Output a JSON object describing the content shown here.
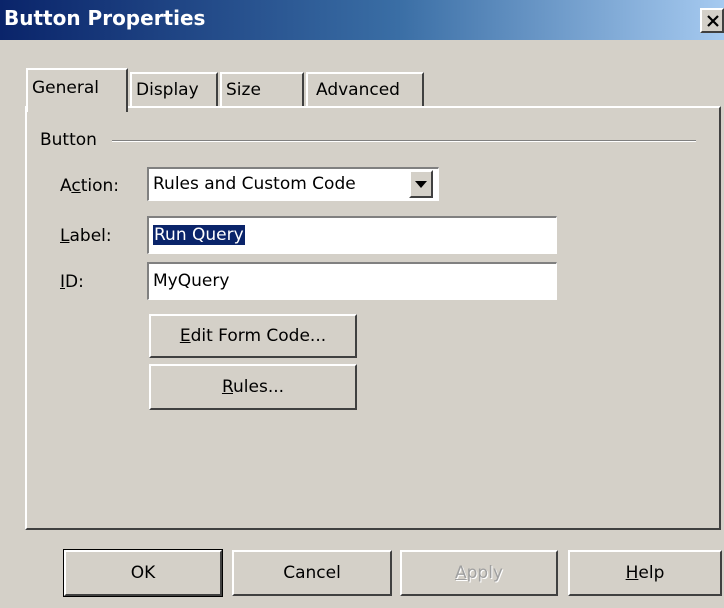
{
  "window": {
    "title": "Button Properties",
    "close_glyph": "✕",
    "accent": "#0a246a"
  },
  "tabs": [
    {
      "label": "General",
      "active": true
    },
    {
      "label": "Display",
      "active": false
    },
    {
      "label": "Size",
      "active": false
    },
    {
      "label": "Advanced",
      "active": false
    }
  ],
  "group": {
    "label": "Button"
  },
  "fields": {
    "action": {
      "label_pre": "A",
      "label_u": "c",
      "label_post": "tion:",
      "value": "Rules and Custom Code"
    },
    "label": {
      "label_pre": "",
      "label_u": "L",
      "label_post": "abel:",
      "value": "Run Query"
    },
    "id": {
      "label_pre": "",
      "label_u": "I",
      "label_post": "D:",
      "value": "MyQuery"
    }
  },
  "inner_buttons": {
    "edit_form_code": {
      "pre": "",
      "u": "E",
      "post": "dit Form Code..."
    },
    "rules": {
      "pre": "",
      "u": "R",
      "post": "ules..."
    }
  },
  "footer": {
    "ok": {
      "pre": "OK",
      "u": "",
      "post": ""
    },
    "cancel": {
      "pre": "Cancel",
      "u": "",
      "post": ""
    },
    "apply": {
      "pre": "",
      "u": "A",
      "post": "pply",
      "disabled": true
    },
    "help": {
      "pre": "",
      "u": "H",
      "post": "elp"
    }
  }
}
